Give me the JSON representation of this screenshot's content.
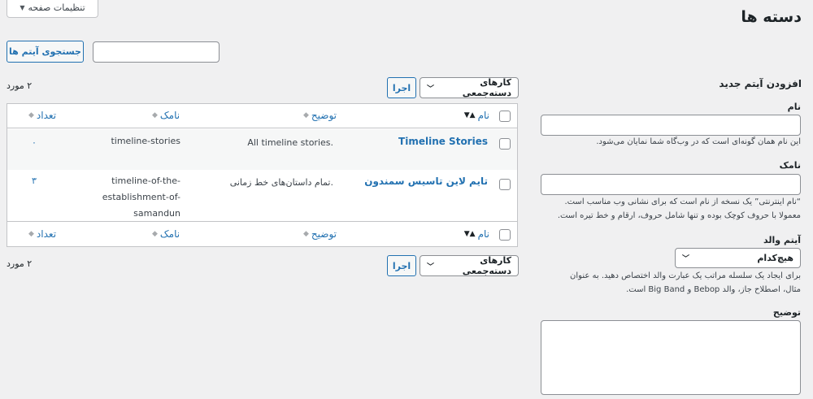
{
  "screen_options": {
    "label": "تنظیمات صفحه"
  },
  "page": {
    "title": "دسته ها"
  },
  "search": {
    "button_label": "جستجوی آیتم ها",
    "value": ""
  },
  "form": {
    "heading": "افزودن آیتم جدید",
    "name_label": "نام",
    "name_help": "این نام همان گونه‌ای است که در وب‌گاه شما نمایان می‌شود.",
    "slug_label": "نامک",
    "slug_help_1": "“نام اینترنتی” یک نسخه از نام است که برای نشانی وب مناسب است.",
    "slug_help_2": "معمولا با حروف کوچک بوده و تنها شامل حروف، ارقام و خط تیره است.",
    "parent_label": "آیتم والد",
    "parent_value": "هیچ‌کدام",
    "parent_help_1": "برای ایجاد یک سلسله مراتب یک عبارت والد اختصاص دهید. به عنوان",
    "parent_help_2": "مثال، اصطلاح جاز، والد Bebop و Big Band است.",
    "description_label": "توضیح"
  },
  "bulk": {
    "select_label": "کارهای دسته‌جمعی",
    "apply_label": "اجرا",
    "count": "۲ مورد"
  },
  "table": {
    "columns": {
      "name": "نام",
      "description": "توضیح",
      "slug": "نامک",
      "count": "تعداد"
    },
    "rows": [
      {
        "name": "Timeline Stories",
        "description": "All timeline stories.",
        "slug": "timeline-stories",
        "count": "۰"
      },
      {
        "name": "تایم لاین تاسیس سمندون",
        "description": "تمام داستان‌های خط زمانی.",
        "slug_1": "timeline-of-the-",
        "slug_2": "establishment-of-",
        "slug_3": "samandun",
        "count": "۳"
      }
    ]
  },
  "colors": {
    "link": "#2271b1",
    "background": "#f0f0f1",
    "border": "#c3c4c7"
  },
  "icons": {
    "sort": "sort-arrows-icon",
    "dropdown": "chevron-down-icon",
    "screen_options": "caret-down-icon"
  }
}
